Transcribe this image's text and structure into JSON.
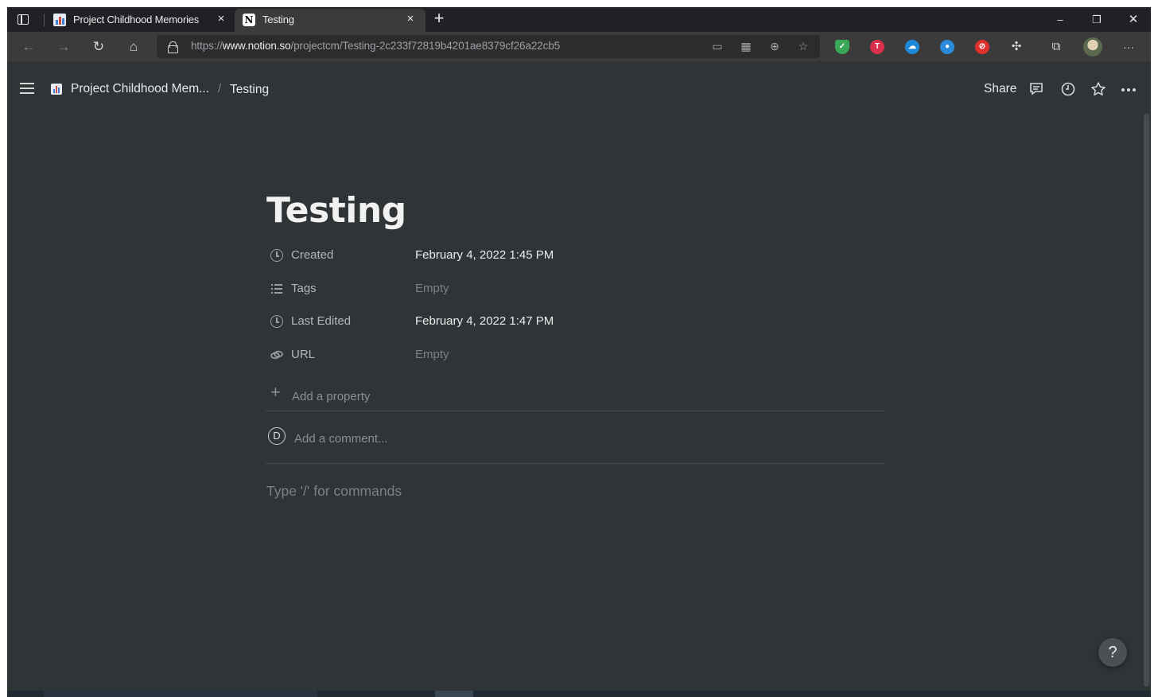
{
  "browser": {
    "tabs": [
      {
        "title": "Project Childhood Memories",
        "close": "×",
        "active": false
      },
      {
        "title": "Testing",
        "close": "×",
        "active": true
      }
    ],
    "new_tab_glyph": "+",
    "address": {
      "scheme": "https://",
      "host": "www.notion.so",
      "path": "/projectcm/Testing-2c233f72819b4201ae8379cf26a22cb5"
    },
    "window_controls": {
      "minimize": "–",
      "restore": "❐",
      "close": "✕"
    },
    "toolbar_more": "···"
  },
  "notion": {
    "breadcrumb": {
      "parent": "Project Childhood Mem...",
      "separator": "/",
      "current": "Testing"
    },
    "share_label": "Share",
    "page": {
      "title": "Testing",
      "properties": [
        {
          "name": "Created",
          "value": "February 4, 2022 1:45 PM",
          "icon": "clock-icon",
          "empty": false
        },
        {
          "name": "Tags",
          "value": "Empty",
          "icon": "list-icon",
          "empty": true
        },
        {
          "name": "Last Edited",
          "value": "February 4, 2022 1:47 PM",
          "icon": "clock-icon",
          "empty": false
        },
        {
          "name": "URL",
          "value": "Empty",
          "icon": "link-icon",
          "empty": true
        }
      ],
      "add_property_label": "Add a property",
      "comment": {
        "avatar_initial": "D",
        "placeholder": "Add a comment..."
      },
      "body_placeholder": "Type '/' for commands"
    },
    "help_label": "?"
  },
  "colors": {
    "background": "#2f3437",
    "tabstrip": "#202124",
    "toolbar": "#3b3b3b",
    "text": "#ececec",
    "muted_text": "#7d8184"
  }
}
